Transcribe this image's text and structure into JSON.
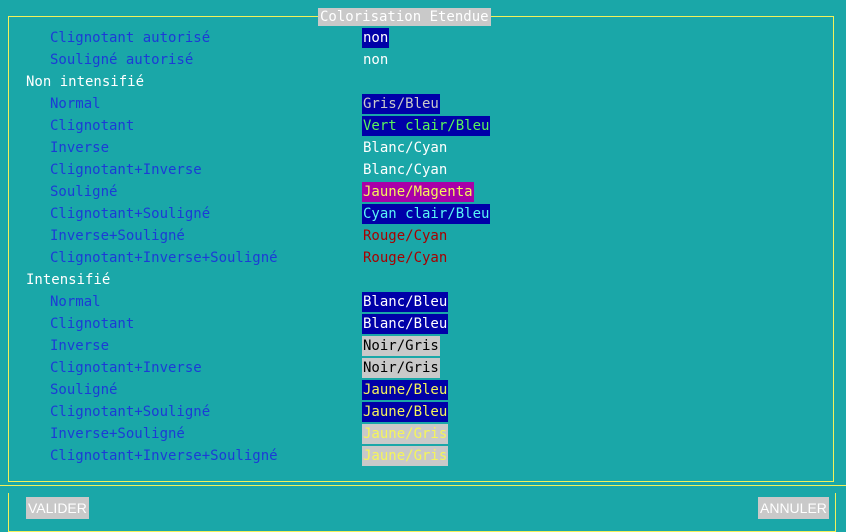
{
  "window_title": "Colorisation Etendue",
  "rows": [
    {
      "label": "Clignotant autorisé",
      "value": "non"
    },
    {
      "label": "Souligné autorisé",
      "value": "non"
    },
    {
      "label": "Non intensifié"
    },
    {
      "label": "Normal",
      "value": "Gris/Bleu"
    },
    {
      "label": "Clignotant",
      "value": "Vert clair/Bleu"
    },
    {
      "label": "Inverse",
      "value": "Blanc/Cyan"
    },
    {
      "label": "Clignotant+Inverse",
      "value": "Blanc/Cyan"
    },
    {
      "label": "Souligné",
      "value": "Jaune/Magenta"
    },
    {
      "label": "Clignotant+Souligné",
      "value": "Cyan clair/Bleu"
    },
    {
      "label": "Inverse+Souligné",
      "value": "Rouge/Cyan"
    },
    {
      "label": "Clignotant+Inverse+Souligné",
      "value": "Rouge/Cyan"
    },
    {
      "label": "Intensifié"
    },
    {
      "label": "Normal",
      "value": "Blanc/Bleu"
    },
    {
      "label": "Clignotant",
      "value": "Blanc/Bleu"
    },
    {
      "label": "Inverse",
      "value": "Noir/Gris"
    },
    {
      "label": "Clignotant+Inverse",
      "value": "Noir/Gris"
    },
    {
      "label": "Souligné",
      "value": "Jaune/Bleu"
    },
    {
      "label": "Clignotant+Souligné",
      "value": "Jaune/Bleu"
    },
    {
      "label": "Inverse+Souligné",
      "value": "Jaune/Gris"
    },
    {
      "label": "Clignotant+Inverse+Souligné",
      "value": "Jaune/Gris"
    }
  ],
  "buttons": {
    "validate": "VALIDER",
    "cancel": "ANNULER"
  },
  "colors": {
    "background": "#1aa7a8",
    "border": "#f2f25a",
    "label_blue": "#1c3bd6",
    "dark_blue": "#0000a8",
    "magenta": "#a800a8",
    "red": "#a80000",
    "grey": "#c9c9c9",
    "yellow": "#f5f55a",
    "light_green": "#5af55a",
    "light_cyan": "#5af5f5"
  }
}
